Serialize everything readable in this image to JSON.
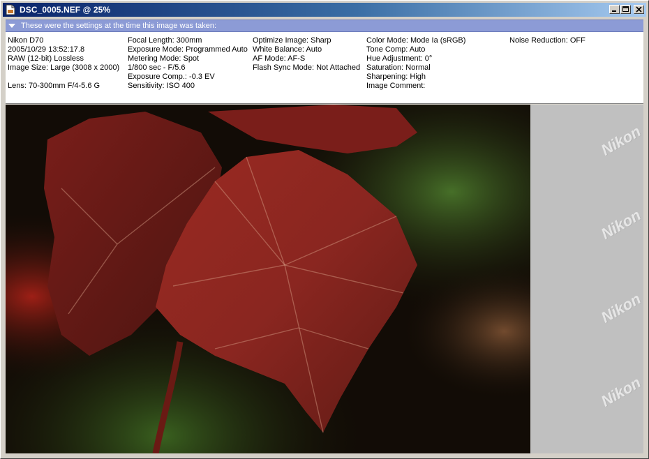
{
  "window": {
    "title": "DSC_0005.NEF @ 25%"
  },
  "info": {
    "header": "These were the settings at the time this image was taken:",
    "col1": [
      "Nikon D70",
      "2005/10/29 13:52:17.8",
      "RAW (12-bit) Lossless",
      "Image Size:  Large (3008 x 2000)",
      "",
      "Lens: 70-300mm F/4-5.6 G"
    ],
    "col2": [
      "Focal Length: 300mm",
      "Exposure Mode: Programmed Auto",
      "Metering Mode: Spot",
      "1/800 sec - F/5.6",
      "Exposure Comp.: -0.3 EV",
      "Sensitivity: ISO 400"
    ],
    "col3": [
      "Optimize Image: Sharp",
      "White Balance: Auto",
      "AF Mode: AF-S",
      "Flash Sync Mode: Not Attached"
    ],
    "col4": [
      "Color Mode: Mode Ia (sRGB)",
      "Tone Comp: Auto",
      "Hue Adjustment: 0°",
      "Saturation:  Normal",
      "Sharpening: High",
      "Image Comment:"
    ],
    "col5": [
      "Noise Reduction: OFF"
    ]
  },
  "watermark": "Nikon",
  "icons": {
    "title": "document-icon",
    "minimize": "minimize-icon",
    "maximize": "maximize-icon",
    "close": "close-icon",
    "collapse": "triangle-down-icon"
  },
  "colors": {
    "title_start": "#0a246a",
    "title_end": "#a6caf0",
    "info_header": "#8c9bd6",
    "leaf": "#8e2420"
  }
}
